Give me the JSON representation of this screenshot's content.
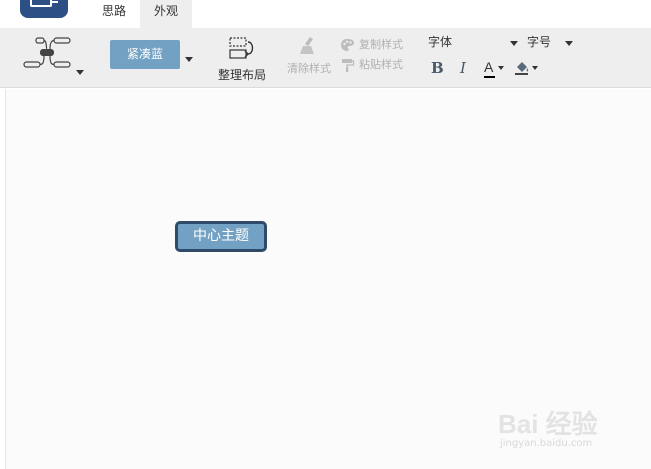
{
  "app": {
    "logo_icon": "mindmap-logo-icon"
  },
  "tabs": [
    {
      "label": "思路",
      "active": false
    },
    {
      "label": "外观",
      "active": true
    }
  ],
  "toolbar": {
    "structure_icon": "mindmap-structure-icon",
    "theme_label": "紧凑蓝",
    "theme_color": "#73a1c3",
    "layout_label": "整理布局",
    "clear_style_label": "清除样式",
    "copy_style_label": "复制样式",
    "paste_style_label": "粘贴样式",
    "font_label": "字体",
    "size_label": "字号",
    "bold_label": "B",
    "italic_label": "I",
    "font_color_label": "A",
    "disabled_color": "#b0b0b0"
  },
  "canvas": {
    "background": "#fbfbfb",
    "root_node": {
      "label": "中心主题",
      "fill": "#73a1c3",
      "border": "#2f4b69"
    }
  },
  "watermark": {
    "title": "Bai 经验",
    "subtitle": "jingyan.baidu.com"
  }
}
